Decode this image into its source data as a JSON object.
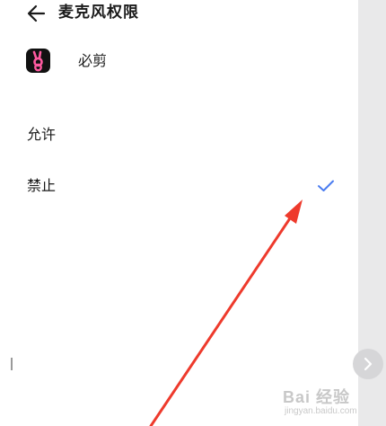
{
  "header": {
    "title": "麦克风权限",
    "back_icon": "arrow-left-icon"
  },
  "app": {
    "name": "必剪",
    "icon": "bijian-app-icon",
    "icon_bg": "#111111"
  },
  "options": [
    {
      "label": "允许",
      "selected": false
    },
    {
      "label": "禁止",
      "selected": true
    }
  ],
  "check_icon": "checkmark-icon",
  "check_color": "#4a7cf0",
  "annotation_arrow_color": "#ee3a2c",
  "next_icon": "chevron-right-icon",
  "watermark": {
    "text": "Bai 经验",
    "sub": "jingyan.baidu.com"
  }
}
